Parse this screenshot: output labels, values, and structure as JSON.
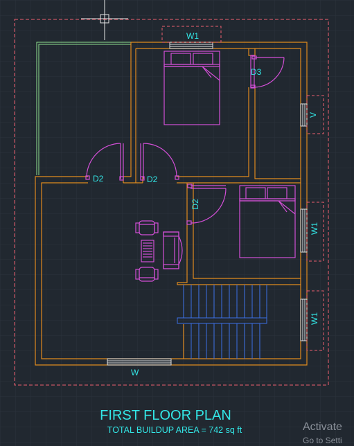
{
  "plan": {
    "title": "FIRST FLOOR PLAN",
    "subtitle": "TOTAL BUILDUP AREA = 742 sq ft",
    "labels": {
      "w1_top": "W1",
      "d3": "D3",
      "v": "V",
      "d2_left": "D2",
      "d2_mid": "D2",
      "d2_vertical": "D2",
      "w1_right_upper": "W1",
      "w1_right_lower": "W1",
      "w_bottom": "W"
    }
  },
  "watermark": {
    "line1": "Activate",
    "line2": "Go to Setti"
  },
  "colors": {
    "background": "#212830",
    "grid": "#2b333c",
    "wall": "#e08a1e",
    "furniture": "#d24fd6",
    "label": "#33e6e6",
    "boundary": "#f06070",
    "stair": "#3a6fe6",
    "window": "#d9d9d9",
    "green_wall": "#8fe08f"
  }
}
